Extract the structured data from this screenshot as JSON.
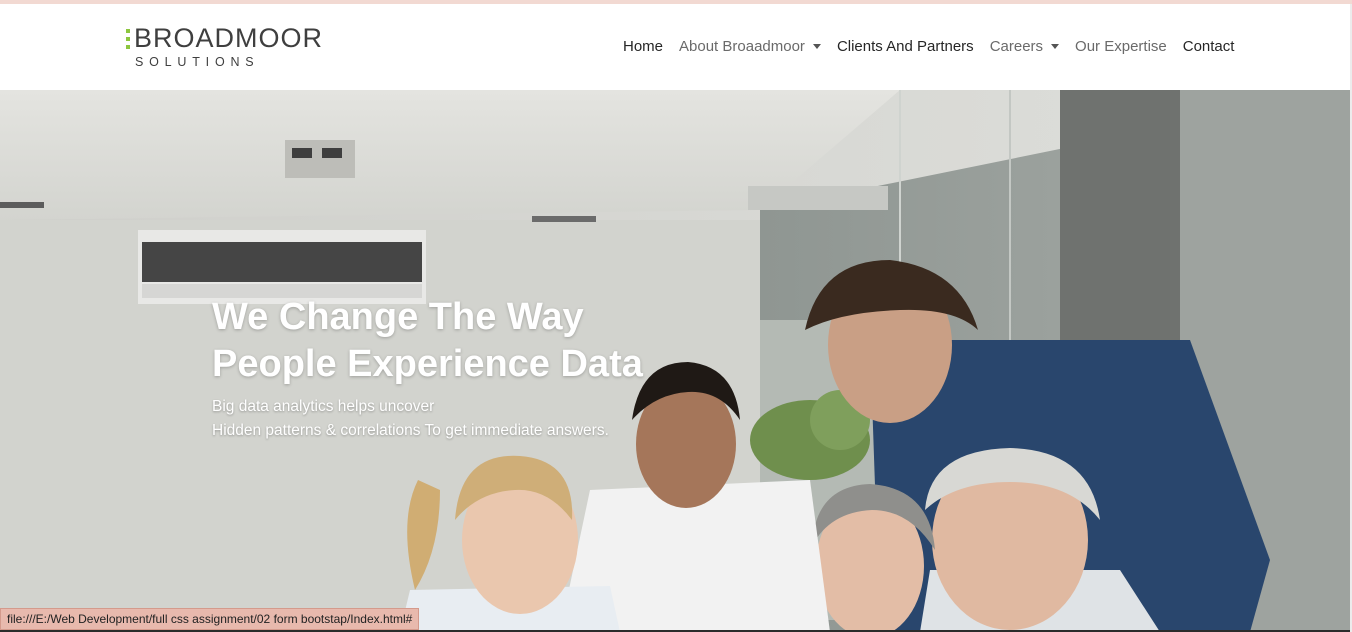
{
  "brand": {
    "name": "BROADMOOR",
    "tagline": "SOLUTIONS",
    "accent_color": "#8dc63f",
    "text_color": "#3f3f3f"
  },
  "nav": {
    "items": [
      {
        "label": "Home",
        "dropdown": false
      },
      {
        "label": "About Broaadmoor",
        "dropdown": true
      },
      {
        "label": "Clients And Partners",
        "dropdown": false
      },
      {
        "label": "Careers",
        "dropdown": true
      },
      {
        "label": "Our Expertise",
        "dropdown": false
      },
      {
        "label": "Contact",
        "dropdown": false
      }
    ]
  },
  "hero": {
    "title_line1": "We Change The Way",
    "title_line2": "People Experience Data",
    "subtitle_line1": "Big data analytics helps uncover",
    "subtitle_line2": "Hidden patterns & correlations To get immediate answers.",
    "image": "office-team-meeting-photo"
  },
  "status": {
    "url": "file:///E:/Web Development/full css assignment/02 form bootstap/Index.html#"
  }
}
